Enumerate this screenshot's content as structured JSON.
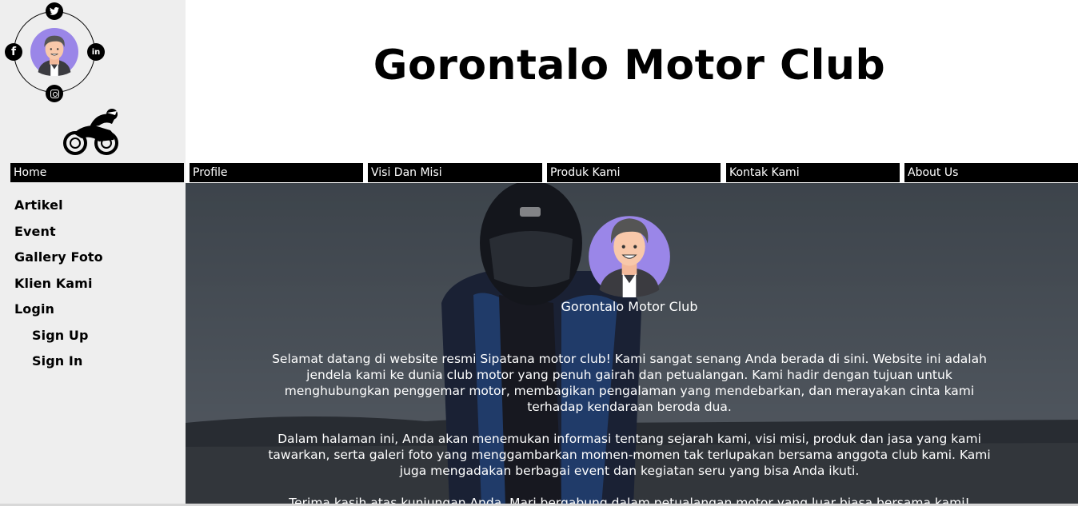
{
  "header": {
    "title": "Gorontalo Motor Club"
  },
  "social_icons": [
    "twitter-icon",
    "facebook-icon",
    "linkedin-icon",
    "instagram-icon"
  ],
  "nav": {
    "items": [
      "Home",
      "Profile",
      "Visi Dan Misi",
      "Produk Kami",
      "Kontak Kami",
      "About Us"
    ]
  },
  "sidebar": {
    "items": [
      "Artikel",
      "Event",
      "Gallery Foto",
      "Klien Kami",
      "Login"
    ],
    "login_sub": [
      "Sign Up",
      "Sign In"
    ]
  },
  "hero": {
    "name": "Gorontalo Motor Club",
    "paragraphs": [
      "Selamat datang di website resmi Sipatana motor club! Kami sangat senang Anda berada di sini. Website ini adalah jendela kami ke dunia club motor yang penuh gairah dan petualangan. Kami hadir dengan tujuan untuk menghubungkan penggemar motor, membagikan pengalaman yang mendebarkan, dan merayakan cinta kami terhadap kendaraan beroda dua.",
      "Dalam halaman ini, Anda akan menemukan informasi tentang sejarah kami, visi misi, produk dan jasa yang kami tawarkan, serta galeri foto yang menggambarkan momen-momen tak terlupakan bersama anggota club kami. Kami juga mengadakan berbagai event dan kegiatan seru yang bisa Anda ikuti.",
      "Terima kasih atas kunjungan Anda. Mari bergabung dalam petualangan motor yang luar biasa bersama kami!"
    ]
  },
  "colors": {
    "sidebar_bg": "#eeeeee",
    "nav_bg": "#000000",
    "avatar_bg": "#9a86e8"
  }
}
